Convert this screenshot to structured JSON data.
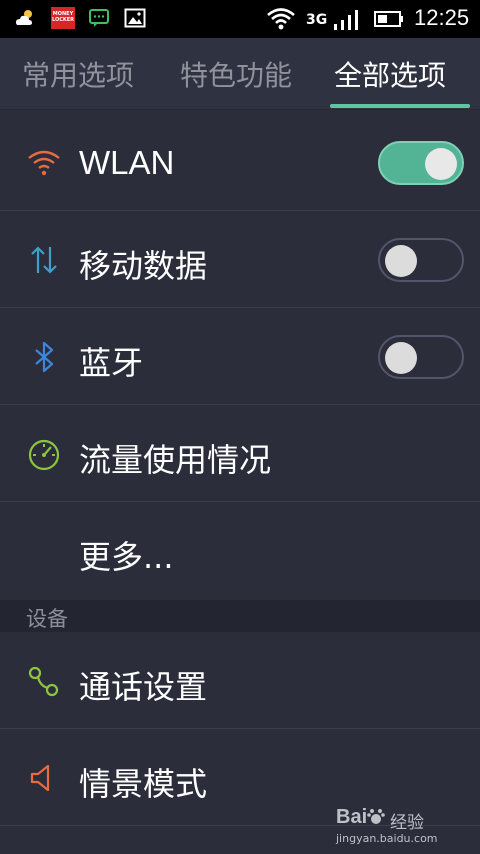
{
  "status_bar": {
    "money_icon_text": "MONEY LOCKER",
    "network": "3G",
    "time": "12:25"
  },
  "tabs": [
    {
      "label": "常用选项",
      "active": false
    },
    {
      "label": "特色功能",
      "active": false
    },
    {
      "label": "全部选项",
      "active": true
    }
  ],
  "rows": [
    {
      "label": "WLAN",
      "icon": "wifi-icon",
      "toggle": true,
      "toggle_on": true
    },
    {
      "label": "移动数据",
      "icon": "arrows-up-down-icon",
      "toggle": true,
      "toggle_on": false
    },
    {
      "label": "蓝牙",
      "icon": "bluetooth-icon",
      "toggle": true,
      "toggle_on": false
    },
    {
      "label": "流量使用情况",
      "icon": "data-usage-gauge-icon",
      "toggle": false
    },
    {
      "label": "更多...",
      "icon": "",
      "toggle": false
    }
  ],
  "section": {
    "label": "设备"
  },
  "device_rows": [
    {
      "label": "通话设置",
      "icon": "call-settings-icon"
    },
    {
      "label": "情景模式",
      "icon": "speaker-icon"
    }
  ],
  "watermark": {
    "text": "经验",
    "site": "jingyan.baidu.com"
  },
  "colors": {
    "background": "#2b2d3b",
    "accent": "#5ec4a4",
    "wifi_icon": "#e56c3f",
    "mobile_data_icon": "#3fa0c8",
    "bluetooth_icon": "#3f86d8",
    "data_usage_icon": "#8cc63f",
    "call_icon": "#8cc63f",
    "speaker_icon": "#e56c3f"
  }
}
